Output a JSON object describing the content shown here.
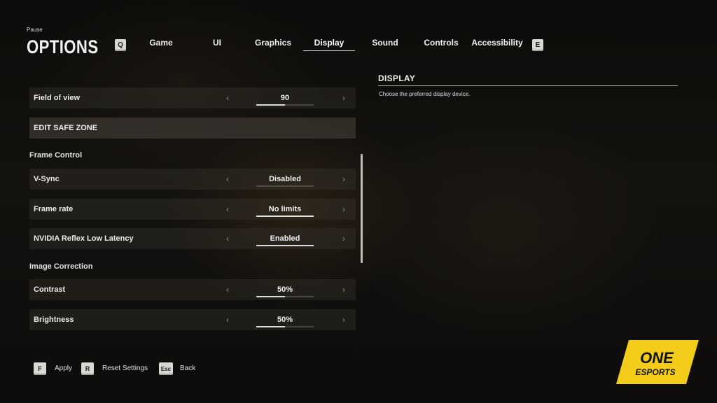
{
  "header": {
    "breadcrumb": "Pause",
    "title": "OPTIONS",
    "prev_key": "Q",
    "next_key": "E"
  },
  "tabs": [
    {
      "label": "Game",
      "active": false
    },
    {
      "label": "UI",
      "active": false
    },
    {
      "label": "Graphics",
      "active": false
    },
    {
      "label": "Display",
      "active": true
    },
    {
      "label": "Sound",
      "active": false
    },
    {
      "label": "Controls",
      "active": false
    },
    {
      "label": "Accessibility",
      "active": false
    }
  ],
  "settings": {
    "field_of_view": {
      "label": "Field of view",
      "value": "90",
      "level": 0.5
    },
    "edit_safe_zone": {
      "label": "EDIT SAFE ZONE"
    },
    "frame_control": {
      "label": "Frame Control"
    },
    "vsync": {
      "label": "V-Sync",
      "value": "Disabled"
    },
    "frame_rate": {
      "label": "Frame rate",
      "value": "No limits",
      "level": 1.0
    },
    "nvidia_reflex": {
      "label": "NVIDIA Reflex Low Latency",
      "value": "Enabled",
      "level": 1.0
    },
    "image_correction": {
      "label": "Image Correction"
    },
    "contrast": {
      "label": "Contrast",
      "value": "50%",
      "level": 0.5
    },
    "brightness": {
      "label": "Brightness",
      "value": "50%",
      "level": 0.5
    }
  },
  "description": {
    "title": "DISPLAY",
    "text": "Choose the preferred display device."
  },
  "footer": {
    "apply": {
      "key": "F",
      "label": "Apply"
    },
    "reset": {
      "key": "R",
      "label": "Reset Settings"
    },
    "back": {
      "key": "Esc",
      "label": "Back"
    }
  },
  "logo": {
    "line1": "ONE",
    "line2": "ESPORTS",
    "color": "#f3cc1a"
  },
  "icons": {
    "chevron_left": "chevron-left-icon",
    "chevron_right": "chevron-right-icon"
  }
}
